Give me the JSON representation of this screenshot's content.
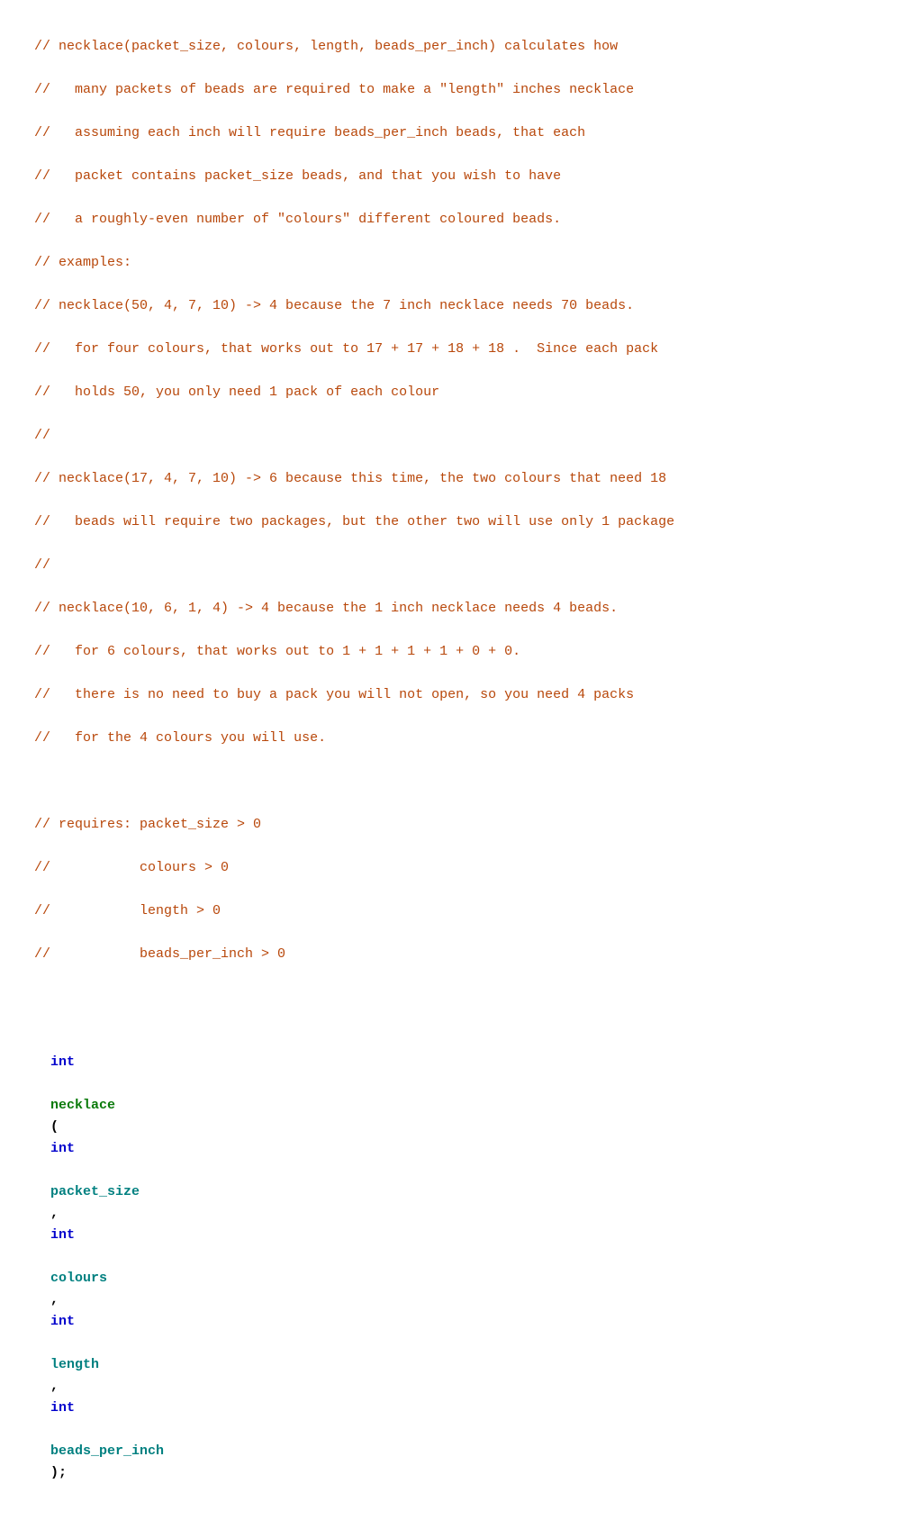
{
  "code": {
    "comments": [
      "// necklace(packet_size, colours, length, beads_per_inch) calculates how",
      "//   many packets of beads are required to make a \"length\" inches necklace",
      "//   assuming each inch will require beads_per_inch beads, that each",
      "//   packet contains packet_size beads, and that you wish to have",
      "//   a roughly-even number of \"colours\" different coloured beads.",
      "// examples:",
      "// necklace(50, 4, 7, 10) -> 4 because the 7 inch necklace needs 70 beads.",
      "//   for four colours, that works out to 17 + 17 + 18 + 18 .  Since each pack",
      "//   holds 50, you only need 1 pack of each colour",
      "//",
      "// necklace(17, 4, 7, 10) -> 6 because this time, the two colours that need 18",
      "//   beads will require two packages, but the other two will use only 1 package",
      "//",
      "// necklace(10, 6, 1, 4) -> 4 because the 1 inch necklace needs 4 beads.",
      "//   for 6 colours, that works out to 1 + 1 + 1 + 1 + 0 + 0.",
      "//   there is no need to buy a pack you will not open, so you need 4 packs",
      "//   for the 4 colours you will use.",
      "",
      "// requires: packet_size > 0",
      "//           colours > 0",
      "//           length > 0",
      "//           beads_per_inch > 0"
    ],
    "function_line": {
      "int_kw": "int",
      "func_name": "necklace",
      "open_paren": "(",
      "param1_type": "int",
      "param1_name": "packet_size",
      "sep1": ", ",
      "param2_type": "int",
      "param2_name": "colours",
      "sep2": ", ",
      "param3_type": "int",
      "param3_name": "length",
      "sep3": ", ",
      "param4_type": "int",
      "param4_name": "beads_per_inch",
      "close": ");"
    }
  }
}
